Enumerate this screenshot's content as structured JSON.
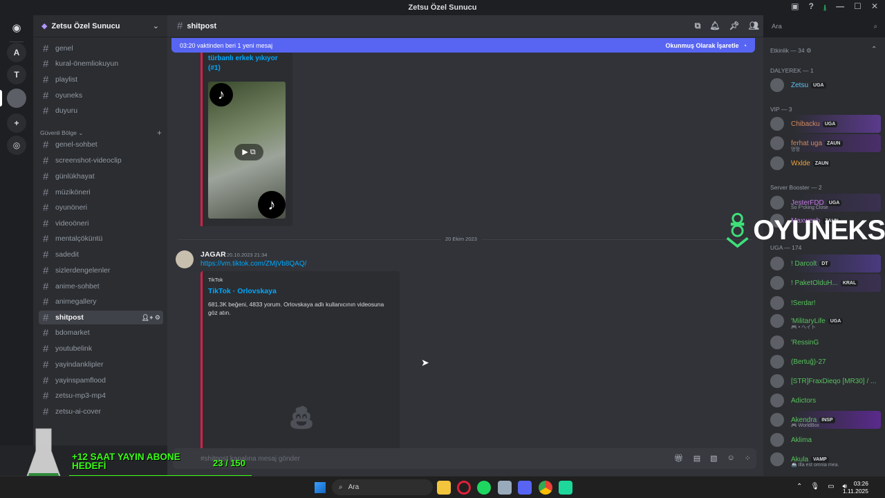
{
  "window": {
    "title": "Zetsu Özel Sunucu"
  },
  "rail": {
    "items": [
      "A",
      "T"
    ]
  },
  "server": {
    "name": "Zetsu Özel Sunucu"
  },
  "channels": {
    "top": [
      "genel",
      "kural-önemliokuyun",
      "playlist",
      "oyuneks",
      "duyuru"
    ],
    "category": "Güvenli Bölge",
    "list": [
      "genel-sohbet",
      "screenshot-videoclip",
      "günlükhayat",
      "müzikönerі",
      "oyunöneri",
      "videoöneri",
      "mentalçöküntü",
      "sadedit",
      "sizlerdengelenler",
      "anime-sohbet",
      "animegallery",
      "shitpost",
      "bdomarket",
      "youtubelink",
      "yayindanklipler",
      "yayinspamflood",
      "zetsu-mp3-mp4",
      "zetsu-ai-cover"
    ],
    "active": "shitpost"
  },
  "header": {
    "channel": "shitpost"
  },
  "newbar": {
    "text": "03:20 vaktinden beri 1 yeni mesaj",
    "mark": "Okunmuş Olarak İşaretle"
  },
  "embed1": {
    "title": "türbanlı erkek yıkıyor (#1)"
  },
  "date_sep": "20 Ekim 2023",
  "message": {
    "author": "JAGAR",
    "time": "20.10.2023 21:34",
    "link": "https://vm.tiktok.com/ZMjVb8QAQ/",
    "provider": "TikTok",
    "embed_title": "TikTok · Orlovskaya",
    "embed_desc": "681.3K beğeni, 4833 yorum. Orlovskaya adlı kullanıcının videosuna göz atın."
  },
  "composer": {
    "placeholder": "#shitpost kanalına mesaj gönder"
  },
  "search": {
    "placeholder": "Ara"
  },
  "members": {
    "activity": "Etkinlik — 34",
    "groups": [
      {
        "label": "DALYEREK — 1"
      },
      {
        "label": "VIP — 3"
      },
      {
        "label": "Server Booster — 2"
      },
      {
        "label": "UGA — 174"
      }
    ],
    "list": [
      {
        "name": "Zetsu",
        "tag": "UGA",
        "color": "#5fc4f3"
      },
      {
        "name": "Chibacku",
        "tag": "UGA",
        "color": "#d38a5c"
      },
      {
        "name": "ferhat uga",
        "tag": "ZAUN",
        "color": "#d38a5c",
        "sub": "멍멍"
      },
      {
        "name": "Wxlde",
        "tag": "ZAUN",
        "color": "#f0a33c"
      },
      {
        "name": "JesterFDD",
        "tag": "UGA",
        "color": "#c47ae6",
        "sub": "So F*cking Close"
      },
      {
        "name": "Maxwesh",
        "tag": "ZAUN",
        "color": "#c47ae6"
      },
      {
        "name": "! Darcolt",
        "tag": "DT",
        "color": "#57c25c"
      },
      {
        "name": "! PaketOlduH...",
        "tag": "KRAL",
        "color": "#57c25c"
      },
      {
        "name": "!Serdar!",
        "tag": "",
        "color": "#57c25c"
      },
      {
        "name": "'MilitaryLife",
        "tag": "UGA",
        "color": "#57c25c",
        "sub": "🎮 • ヘイト"
      },
      {
        "name": "'RessinG",
        "tag": "",
        "color": "#57c25c"
      },
      {
        "name": "(Bertuğ)-27",
        "tag": "",
        "color": "#57c25c"
      },
      {
        "name": "[STR]FraxDieqo [MR30] / ...",
        "tag": "",
        "color": "#57c25c"
      },
      {
        "name": "Adictors",
        "tag": "",
        "color": "#57c25c"
      },
      {
        "name": "Akendra",
        "tag": "INSP",
        "color": "#57c25c",
        "sub": "🎮 WorldBox"
      },
      {
        "name": "Aklima",
        "tag": "",
        "color": "#57c25c"
      },
      {
        "name": "Akula",
        "tag": "VAMP",
        "color": "#57c25c",
        "sub": "🚢 Illa est omnia mea."
      }
    ]
  },
  "overlay": {
    "brand": "OYUNEKS"
  },
  "goal": {
    "title_line1": "+12 SAAT YAYIN ABONE",
    "title_line2": "HEDEFİ",
    "count": "23 / 150",
    "progress": 0.153
  },
  "taskbar": {
    "search": "Ara",
    "time": "03:26",
    "date": "1.11.2025"
  },
  "colors": {
    "blurple": "#5865f2",
    "embed_border": "#e01b48",
    "goal_green": "#39ff14"
  }
}
